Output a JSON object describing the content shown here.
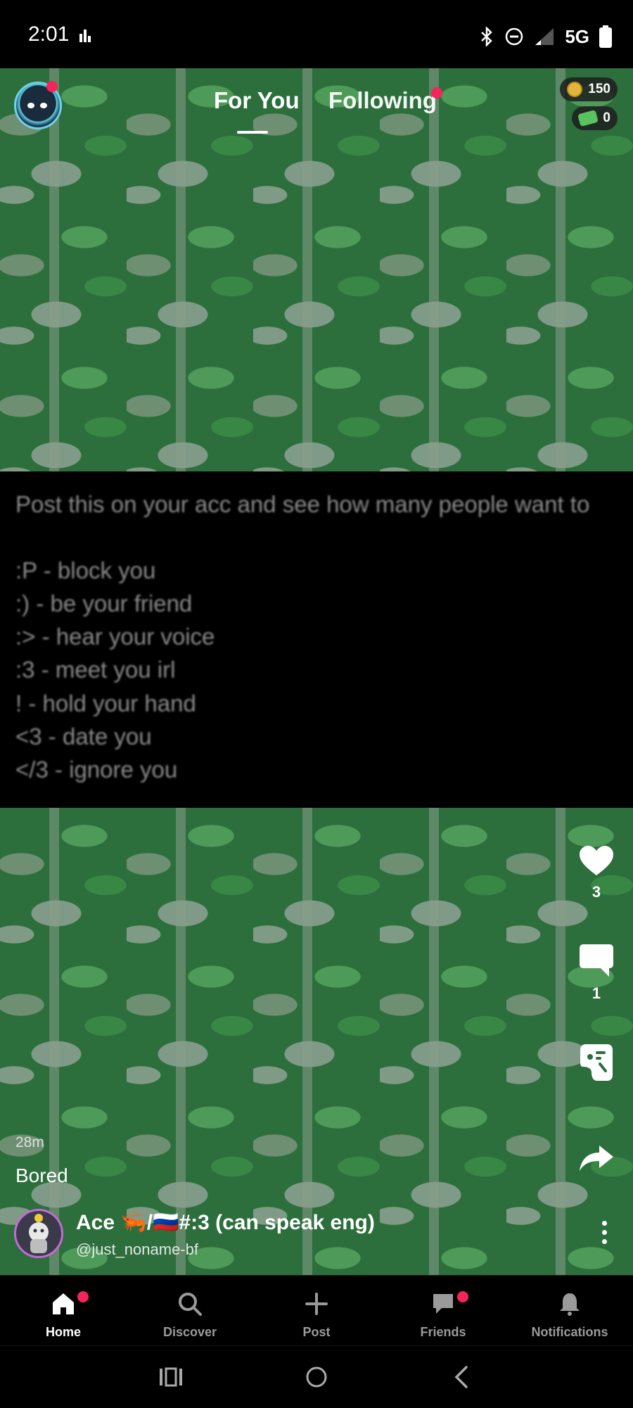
{
  "status_bar": {
    "time": "2:01",
    "network": "5G"
  },
  "header": {
    "tabs": [
      {
        "label": "For You",
        "active": true
      },
      {
        "label": "Following",
        "active": false,
        "has_dot": true
      }
    ],
    "coins": "150",
    "cash": "0"
  },
  "post": {
    "lines": [
      "Post this on your acc and see how many people want to",
      "",
      ":P - block you",
      ":) - be your friend",
      ":> - hear your voice",
      ":3 - meet you irl",
      "! - hold your hand",
      "<3 - date you",
      "</3 - ignore you"
    ],
    "time_ago": "28m",
    "caption": "Bored",
    "author_name": "Ace 🦐/🇷🇺#:3 (can speak eng)",
    "author_handle": "@just_noname-bf"
  },
  "actions": {
    "likes": "3",
    "comments": "1"
  },
  "bottom_nav": [
    {
      "label": "Home",
      "icon": "home-icon",
      "active": true,
      "has_dot": true
    },
    {
      "label": "Discover",
      "icon": "search-icon",
      "active": false
    },
    {
      "label": "Post",
      "icon": "plus-icon",
      "active": false
    },
    {
      "label": "Friends",
      "icon": "chat-icon",
      "active": false,
      "has_dot": true
    },
    {
      "label": "Notifications",
      "icon": "bell-icon",
      "active": false
    }
  ],
  "colors": {
    "accent_red": "#f5245a",
    "background": "#000000",
    "leaf_green": "#2c6e3c"
  }
}
